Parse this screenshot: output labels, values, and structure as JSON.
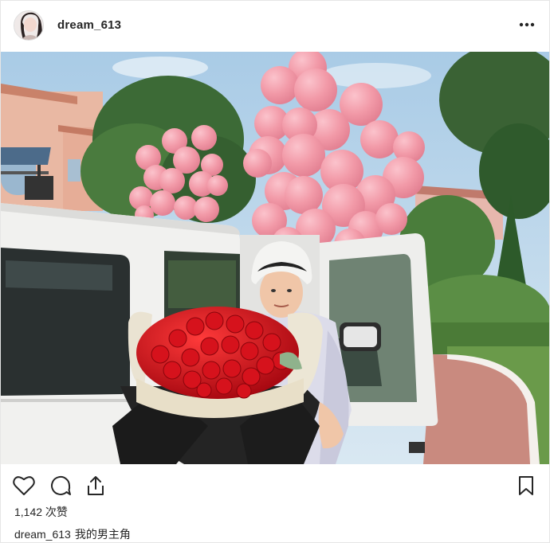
{
  "post": {
    "username": "dream_613",
    "more_icon": "more-horizontal-icon",
    "likes_text": "1,142 次赞",
    "caption": {
      "username": "dream_613",
      "text": "我的男主角"
    },
    "actions": {
      "like_icon": "heart-icon",
      "comment_icon": "comment-icon",
      "share_icon": "share-icon",
      "save_icon": "bookmark-icon"
    },
    "colors": {
      "balloon_pink": "#f08fa0",
      "rose_red": "#c8101a",
      "car_white": "#f2f2f0",
      "text": "#262626"
    }
  }
}
